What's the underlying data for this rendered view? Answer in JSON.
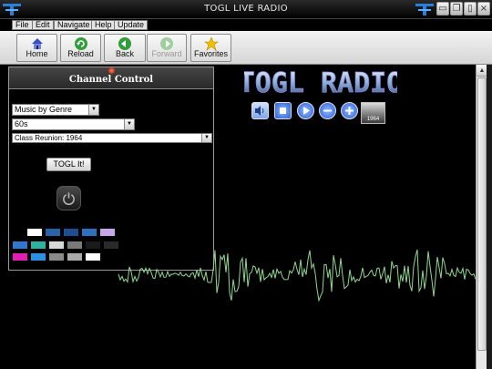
{
  "window": {
    "title": "TOGL LIVE RADIO",
    "controls": [
      "minimize",
      "restore",
      "maximize",
      "close"
    ]
  },
  "menu": {
    "items": [
      "File",
      "Edit",
      "Navigate",
      "Help",
      "Update"
    ]
  },
  "toolbar": {
    "buttons": [
      {
        "label": "Home",
        "icon": "home-icon",
        "enabled": true
      },
      {
        "label": "Reload",
        "icon": "reload-icon",
        "enabled": true
      },
      {
        "label": "Back",
        "icon": "back-icon",
        "enabled": true
      },
      {
        "label": "Forward",
        "icon": "forward-icon",
        "enabled": false
      },
      {
        "label": "Favorites",
        "icon": "star-icon",
        "enabled": true
      }
    ]
  },
  "panel": {
    "title": "Channel Control",
    "mode_select": "Music by Genre",
    "genre_select": "60s",
    "channel_select": "Class Reunion: 1964",
    "togl_button": "TOGL It!"
  },
  "player": {
    "logo": "TOGL RADIO",
    "album_art_text": "1964"
  },
  "theme_swatches": [
    [
      "#ffffff",
      "#2a62a8",
      "#1d4e94",
      "#2f6fbf",
      "#c6a8e8"
    ],
    [
      "#2f78d0",
      "#2bb3a0",
      "#d9d9d9",
      "#7a7a7a",
      "#1a1a1a",
      "#2a2a2a"
    ],
    [
      "#e020b0",
      "#2e8fe0",
      "#8a8a8a",
      "#aaaaaa",
      "#ffffff"
    ]
  ],
  "colors": {
    "waveform": "#8fd88f",
    "panel_bg": "#000000",
    "logo": "#bfe4ff"
  }
}
